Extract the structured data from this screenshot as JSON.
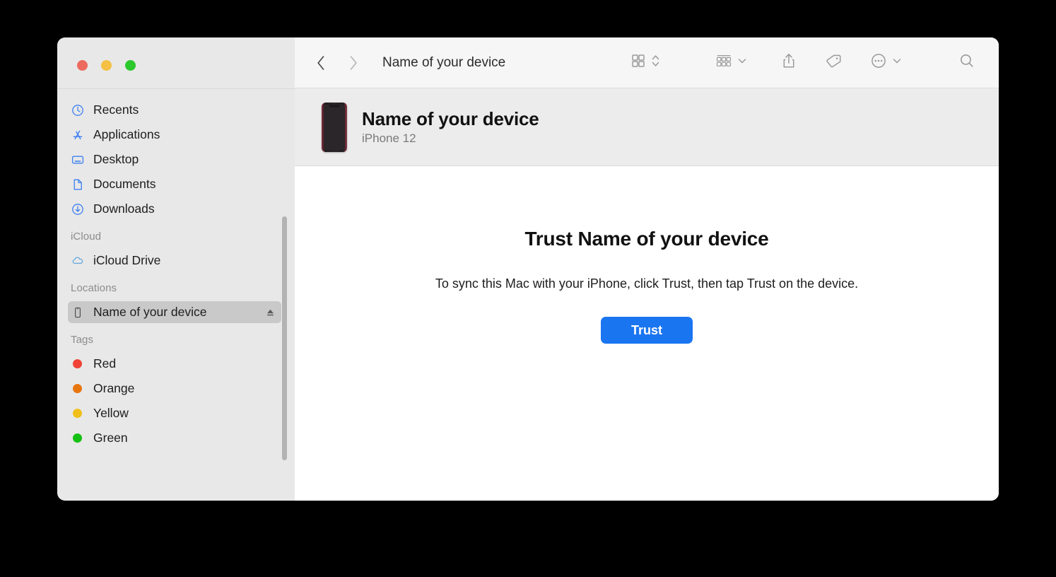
{
  "window": {
    "traffic_lights": [
      {
        "name": "close",
        "color": "#ed6a5e"
      },
      {
        "name": "minimize",
        "color": "#f5c043"
      },
      {
        "name": "zoom",
        "color": "#2cc82c"
      }
    ]
  },
  "toolbar": {
    "title": "Name of your device",
    "back_icon": "chevron-left-icon",
    "forward_icon": "chevron-right-icon",
    "view_icon": "grid-view-icon",
    "view_stepper_icon": "chevron-up-down-icon",
    "group_icon": "group-by-icon",
    "group_chevron_icon": "chevron-down-icon",
    "share_icon": "share-icon",
    "tag_icon": "tag-icon",
    "more_icon": "ellipsis-circle-icon",
    "more_chevron_icon": "chevron-down-icon",
    "search_icon": "search-icon"
  },
  "sidebar": {
    "favorites": [
      {
        "label": "Recents",
        "icon": "clock-icon"
      },
      {
        "label": "Applications",
        "icon": "applications-icon"
      },
      {
        "label": "Desktop",
        "icon": "desktop-icon"
      },
      {
        "label": "Documents",
        "icon": "document-icon"
      },
      {
        "label": "Downloads",
        "icon": "download-icon"
      }
    ],
    "icloud_header": "iCloud",
    "icloud": [
      {
        "label": "iCloud Drive",
        "icon": "cloud-icon"
      }
    ],
    "locations_header": "Locations",
    "locations": [
      {
        "label": "Name of your device",
        "icon": "iphone-icon",
        "selected": true,
        "eject_icon": "eject-icon"
      }
    ],
    "tags_header": "Tags",
    "tags": [
      {
        "label": "Red",
        "color": "#f04236"
      },
      {
        "label": "Orange",
        "color": "#e8760f"
      },
      {
        "label": "Yellow",
        "color": "#f0c019"
      },
      {
        "label": "Green",
        "color": "#14c014"
      }
    ]
  },
  "device_header": {
    "name": "Name of your device",
    "model": "iPhone 12",
    "thumbnail_icon": "iphone-thumbnail"
  },
  "main": {
    "heading": "Trust Name of your device",
    "description": "To sync this Mac with your iPhone, click Trust, then tap Trust on the device.",
    "trust_button_label": "Trust",
    "accent_color": "#1a75f0"
  }
}
